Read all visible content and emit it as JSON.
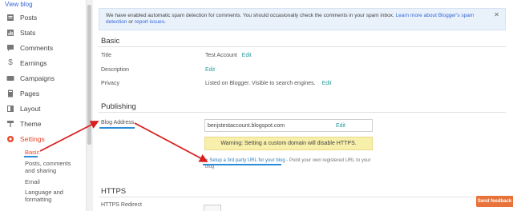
{
  "header": {
    "view_blog": "View blog"
  },
  "sidebar": {
    "items": [
      {
        "label": "Posts",
        "icon": "posts-icon"
      },
      {
        "label": "Stats",
        "icon": "stats-icon"
      },
      {
        "label": "Comments",
        "icon": "comments-icon"
      },
      {
        "label": "Earnings",
        "icon": "earnings-icon"
      },
      {
        "label": "Campaigns",
        "icon": "campaigns-icon"
      },
      {
        "label": "Pages",
        "icon": "pages-icon"
      },
      {
        "label": "Layout",
        "icon": "layout-icon"
      },
      {
        "label": "Theme",
        "icon": "theme-icon"
      },
      {
        "label": "Settings",
        "icon": "settings-icon"
      }
    ],
    "sub_items": [
      "Basic",
      "Posts, comments and sharing",
      "Email",
      "Language and formatting"
    ],
    "accent_color": "#e8462b"
  },
  "notice": {
    "text": "We have enabled automatic spam detection for comments. You should occasionally check the comments in your spam inbox.",
    "link1": "Learn more about",
    "link2": "Blogger's spam detection",
    "mid": " or ",
    "link3": "report issues",
    "end": "."
  },
  "basic": {
    "title": "Basic",
    "rows": [
      {
        "label": "Title",
        "value": "Test Account",
        "edit": "Edit"
      },
      {
        "label": "Description",
        "value": "",
        "edit": "Edit"
      },
      {
        "label": "Privacy",
        "value": "Listed on Blogger. Visible to search engines.",
        "edit": "Edit"
      }
    ]
  },
  "publishing": {
    "title": "Publishing",
    "blog_address_label": "Blog Address",
    "address": "benjstestaccount.blogspot.com",
    "edit": "Edit",
    "warning": "Warning: Setting a custom domain will disable HTTPS.",
    "third_party_prefix": "+",
    "third_party_link": "Setup a 3rd party URL for your blog",
    "third_party_suffix": " - Point your own registered URL to your blog"
  },
  "https": {
    "title": "HTTPS",
    "redirect_label": "HTTPS Redirect"
  },
  "feedback": {
    "label": "Send feedback",
    "color": "#e8733a"
  }
}
